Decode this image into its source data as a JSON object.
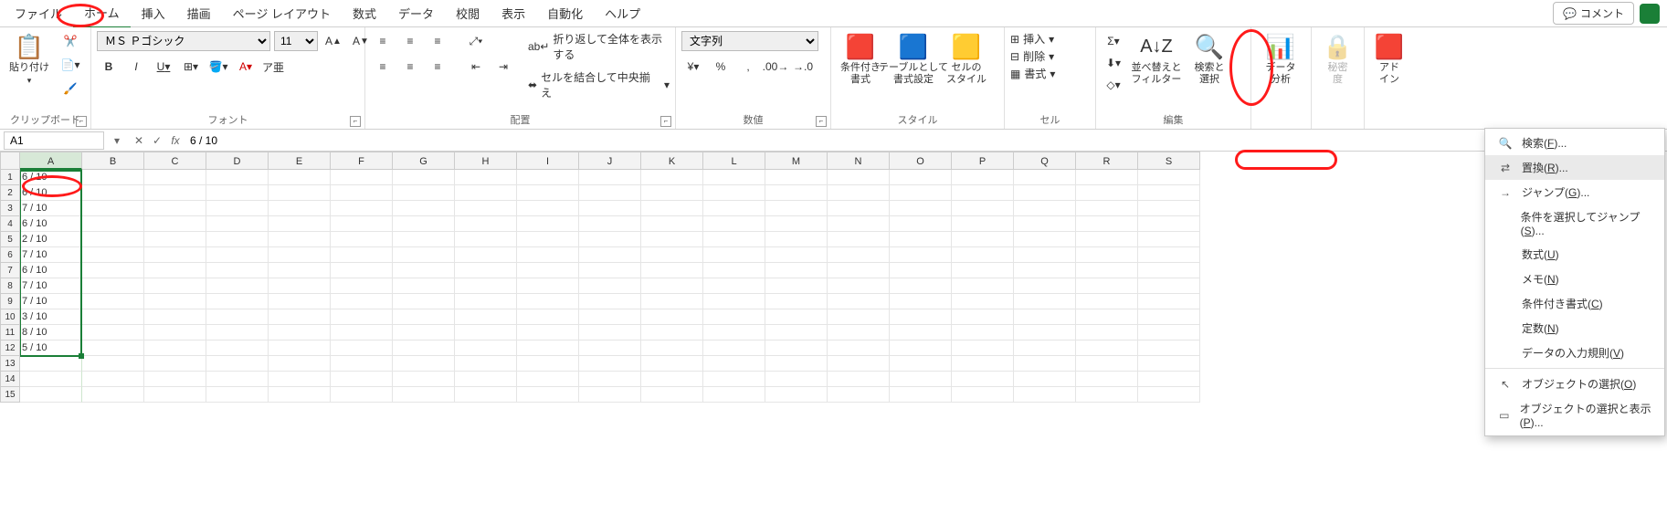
{
  "menu": {
    "tabs": [
      "ファイル",
      "ホーム",
      "挿入",
      "描画",
      "ページ レイアウト",
      "数式",
      "データ",
      "校閲",
      "表示",
      "自動化",
      "ヘルプ"
    ],
    "active_index": 1,
    "comment_btn": "コメント"
  },
  "ribbon": {
    "clipboard": {
      "label": "クリップボード",
      "paste": "貼り付け"
    },
    "font": {
      "label": "フォント",
      "name": "ＭＳ Ｐゴシック",
      "size": "11",
      "bold": "B",
      "italic": "I",
      "underline": "U",
      "ruby": "ア亜"
    },
    "alignment": {
      "label": "配置",
      "wrap": "折り返して全体を表示する",
      "merge": "セルを結合して中央揃え"
    },
    "number": {
      "label": "数値",
      "format": "文字列"
    },
    "styles": {
      "label": "スタイル",
      "cond": "条件付き\n書式",
      "table": "テーブルとして\n書式設定",
      "cell": "セルの\nスタイル"
    },
    "cells": {
      "label": "セル",
      "insert": "挿入",
      "delete": "削除",
      "format": "書式"
    },
    "editing": {
      "label": "編集",
      "sort": "並べ替えと\nフィルター",
      "find": "検索と\n選択"
    },
    "analysis": {
      "data": "データ\n分析",
      "sens": "秘密\n度",
      "addin": "アド\nイン"
    }
  },
  "fx": {
    "cell_ref": "A1",
    "formula": "6 / 10"
  },
  "grid": {
    "cols": [
      "A",
      "B",
      "C",
      "D",
      "E",
      "F",
      "G",
      "H",
      "I",
      "J",
      "K",
      "L",
      "M",
      "N",
      "O",
      "P",
      "Q",
      "R",
      "S"
    ],
    "col_a_values": [
      "6 / 10",
      "6 / 10",
      "7 / 10",
      "6 / 10",
      "2 / 10",
      "7 / 10",
      "6 / 10",
      "7 / 10",
      "7 / 10",
      "3 / 10",
      "8 / 10",
      "5 / 10",
      "",
      "",
      ""
    ],
    "row_count": 15
  },
  "dropdown": {
    "items": [
      {
        "icon": "🔍",
        "label": "検索(",
        "u": "F",
        "tail": ")..."
      },
      {
        "icon": "⇄",
        "label": "置換(",
        "u": "R",
        "tail": ")..."
      },
      {
        "icon": "→",
        "label": "ジャンプ(",
        "u": "G",
        "tail": ")..."
      },
      {
        "icon": "",
        "label": "条件を選択してジャンプ(",
        "u": "S",
        "tail": ")..."
      },
      {
        "icon": "",
        "label": "数式(",
        "u": "U",
        "tail": ")"
      },
      {
        "icon": "",
        "label": "メモ(",
        "u": "N",
        "tail": ")"
      },
      {
        "icon": "",
        "label": "条件付き書式(",
        "u": "C",
        "tail": ")"
      },
      {
        "icon": "",
        "label": "定数(",
        "u": "N",
        "tail": ")"
      },
      {
        "icon": "",
        "label": "データの入力規則(",
        "u": "V",
        "tail": ")"
      },
      {
        "sep": true
      },
      {
        "icon": "↖",
        "label": "オブジェクトの選択(",
        "u": "O",
        "tail": ")"
      },
      {
        "icon": "▭",
        "label": "オブジェクトの選択と表示(",
        "u": "P",
        "tail": ")..."
      }
    ],
    "highlight_index": 1
  }
}
